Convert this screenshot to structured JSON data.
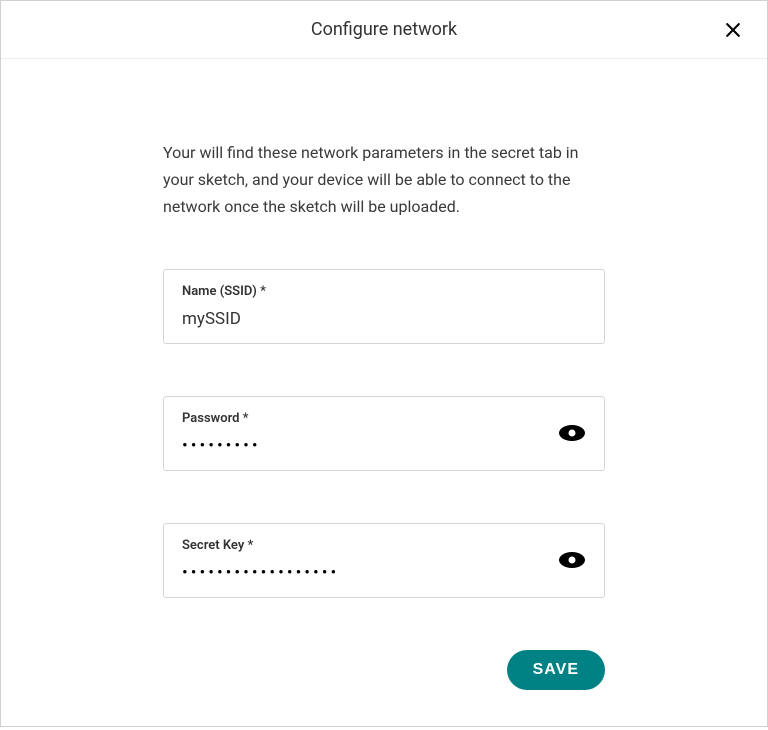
{
  "header": {
    "title": "Configure network"
  },
  "description": "Your will find these network parameters in the secret tab in your sketch, and your device will be able to connect to the network once the sketch will be uploaded.",
  "fields": {
    "ssid": {
      "label": "Name (SSID) *",
      "value": "mySSID"
    },
    "password": {
      "label": "Password *",
      "masked": "•••••••••"
    },
    "secretKey": {
      "label": "Secret Key *",
      "masked": "••••••••••••••••••"
    }
  },
  "actions": {
    "save": "SAVE"
  }
}
